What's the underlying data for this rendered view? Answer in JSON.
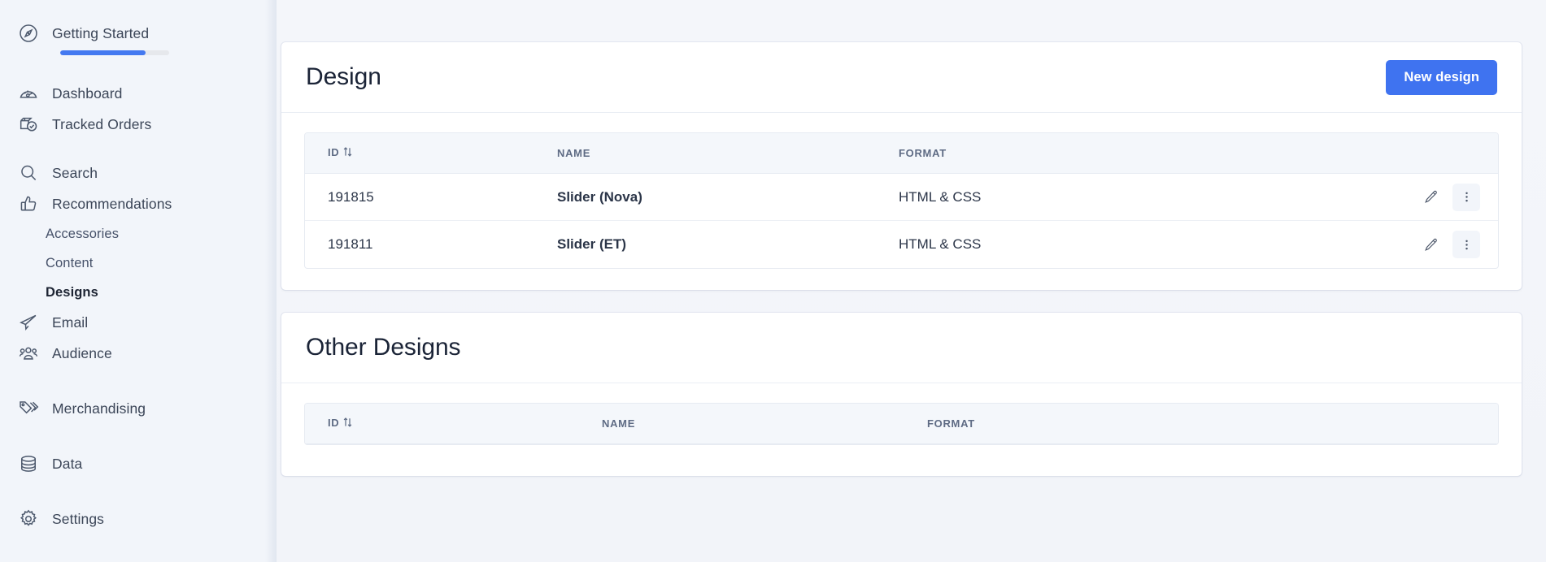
{
  "sidebar": {
    "getting_started": {
      "label": "Getting Started",
      "icon": "compass-icon",
      "progress_percent": 78
    },
    "groups": [
      {
        "items": [
          {
            "label": "Dashboard",
            "icon": "dashboard-gauge-icon",
            "active": false,
            "sub": false
          },
          {
            "label": "Tracked Orders",
            "icon": "tracked-orders-box-check-icon",
            "active": false,
            "sub": false
          }
        ]
      },
      {
        "items": [
          {
            "label": "Search",
            "icon": "search-icon",
            "active": false,
            "sub": false
          },
          {
            "label": "Recommendations",
            "icon": "thumbs-up-icon",
            "active": false,
            "sub": false
          },
          {
            "label": "Accessories",
            "icon": "",
            "active": false,
            "sub": true
          },
          {
            "label": "Content",
            "icon": "",
            "active": false,
            "sub": true
          },
          {
            "label": "Designs",
            "icon": "",
            "active": true,
            "sub": true
          },
          {
            "label": "Email",
            "icon": "paper-plane-icon",
            "active": false,
            "sub": false
          },
          {
            "label": "Audience",
            "icon": "people-group-icon",
            "active": false,
            "sub": false
          }
        ]
      },
      {
        "items": [
          {
            "label": "Merchandising",
            "icon": "tags-icon",
            "active": false,
            "sub": false
          }
        ]
      },
      {
        "items": [
          {
            "label": "Data",
            "icon": "database-icon",
            "active": false,
            "sub": false
          }
        ]
      },
      {
        "items": [
          {
            "label": "Settings",
            "icon": "gear-icon",
            "active": false,
            "sub": false
          }
        ]
      }
    ]
  },
  "design_card": {
    "title": "Design",
    "new_button_label": "New design",
    "columns": [
      "ID",
      "NAME",
      "FORMAT"
    ],
    "sort_icon": "sort-ascending-icon",
    "row_actions": {
      "edit_icon": "pencil-icon",
      "more_icon": "more-vertical-icon"
    },
    "rows": [
      {
        "id": "191815",
        "name": "Slider (Nova)",
        "format": "HTML & CSS"
      },
      {
        "id": "191811",
        "name": "Slider (ET)",
        "format": "HTML & CSS"
      }
    ]
  },
  "other_designs_card": {
    "title": "Other Designs",
    "columns": [
      "ID",
      "NAME",
      "FORMAT"
    ],
    "sort_icon": "sort-ascending-icon",
    "rows": []
  },
  "colors": {
    "accent": "#3f73f0",
    "progress_fill": "#4479f0",
    "page_bg": "#f4f6fa",
    "sidebar_bg": "#f2f5fa",
    "card_bg": "#ffffff",
    "table_header_bg": "#f4f7fb",
    "muted_text": "#a9b2c4",
    "header_text": "#5e6b84"
  }
}
